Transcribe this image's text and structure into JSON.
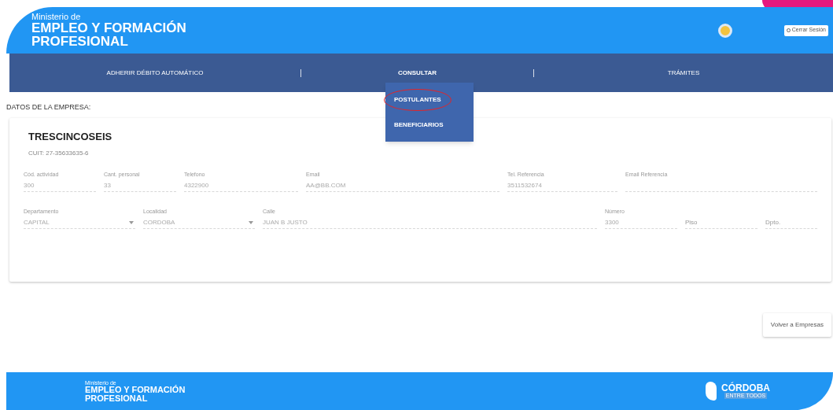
{
  "header": {
    "ministry_prefix": "Ministerio de",
    "ministry_name_line1": "EMPLEO Y FORMACIÓN",
    "ministry_name_line2": "PROFESIONAL",
    "logout_button": "Cerrar Sesión"
  },
  "nav": {
    "items": [
      {
        "label": "ADHERIR DÉBITO AUTOMÁTICO",
        "selected": false
      },
      {
        "label": "CONSULTAR",
        "selected": true
      },
      {
        "label": "TRÁMITES",
        "selected": false
      }
    ],
    "dropdown": [
      {
        "label": "POSTULANTES",
        "circled": true
      },
      {
        "label": "BENEFICIARIOS",
        "circled": false
      }
    ]
  },
  "section_title": "DATOS DE LA EMPRESA:",
  "company": {
    "name": "TRESCINCOSEIS",
    "cuit": "CUIT: 27-35633635-6"
  },
  "field_rows": [
    [
      {
        "kind": "text",
        "label": "Cód. actividad",
        "value": "300"
      },
      {
        "kind": "text",
        "label": "Cant. personal",
        "value": "33"
      },
      {
        "kind": "text",
        "label": "Telefono",
        "value": "4322900"
      },
      {
        "kind": "text",
        "label": "Email",
        "value": "AA@BB.COM"
      },
      {
        "kind": "text",
        "label": "Tel. Referencia",
        "value": "3511532674"
      },
      {
        "kind": "text",
        "label": "Email Referencia"
      }
    ],
    [
      {
        "kind": "select",
        "label": "Departamento",
        "value": "CAPITAL"
      },
      {
        "kind": "select",
        "label": "Localidad",
        "value": "CORDOBA"
      },
      {
        "kind": "text",
        "label": "Calle",
        "value": "JUAN B JUSTO"
      },
      {
        "kind": "text",
        "label": "Número",
        "value": "3300"
      },
      {
        "kind": "text",
        "placeholder": "Piso"
      },
      {
        "kind": "text",
        "placeholder": "Dpto."
      }
    ]
  ],
  "back_button": "Volver a Empresas",
  "footer": {
    "ministry_prefix": "Ministerio de",
    "ministry_name_line1": "EMPLEO Y FORMACIÓN",
    "ministry_name_line2": "PROFESIONAL",
    "province_logo": "CÓRDOBA",
    "province_slogan": "ENTRE TODOS"
  }
}
